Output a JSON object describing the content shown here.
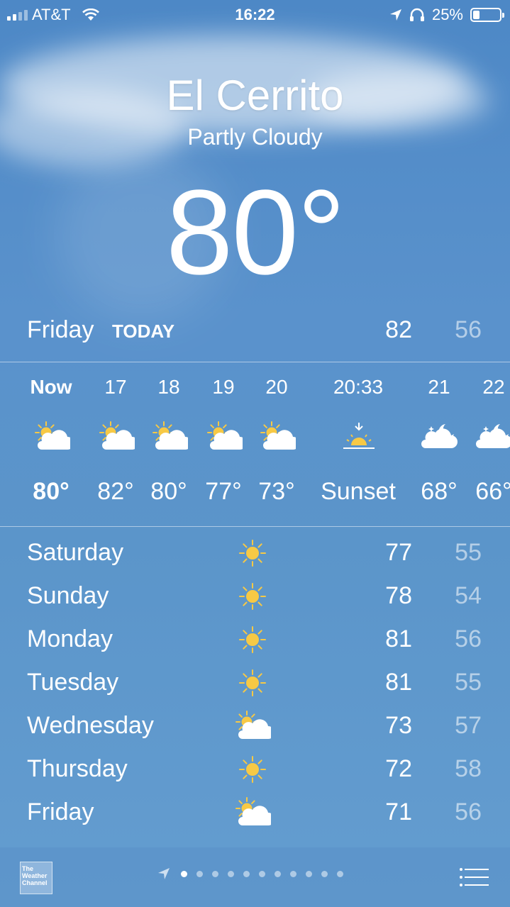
{
  "status_bar": {
    "carrier": "AT&T",
    "time": "16:22",
    "battery": "25%",
    "battery_level": 0.25
  },
  "header": {
    "city": "El Cerrito",
    "condition": "Partly Cloudy",
    "temperature": "80°"
  },
  "today": {
    "day": "Friday",
    "tag": "TODAY",
    "high": "82",
    "low": "56"
  },
  "hourly": [
    {
      "time": "Now",
      "icon": "partly-cloudy-day-icon",
      "value": "80°",
      "bold": true
    },
    {
      "time": "17",
      "icon": "partly-cloudy-day-icon",
      "value": "82°"
    },
    {
      "time": "18",
      "icon": "partly-cloudy-day-icon",
      "value": "80°"
    },
    {
      "time": "19",
      "icon": "partly-cloudy-day-icon",
      "value": "77°"
    },
    {
      "time": "20",
      "icon": "partly-cloudy-day-icon",
      "value": "73°"
    },
    {
      "time": "20:33",
      "icon": "sunset-icon",
      "value": "Sunset"
    },
    {
      "time": "21",
      "icon": "partly-cloudy-night-icon",
      "value": "68°"
    },
    {
      "time": "22",
      "icon": "partly-cloudy-night-icon",
      "value": "66°"
    }
  ],
  "daily": [
    {
      "day": "Saturday",
      "icon": "sun-icon",
      "high": "77",
      "low": "55"
    },
    {
      "day": "Sunday",
      "icon": "sun-icon",
      "high": "78",
      "low": "54"
    },
    {
      "day": "Monday",
      "icon": "sun-icon",
      "high": "81",
      "low": "56"
    },
    {
      "day": "Tuesday",
      "icon": "sun-icon",
      "high": "81",
      "low": "55"
    },
    {
      "day": "Wednesday",
      "icon": "partly-cloudy-day-icon",
      "high": "73",
      "low": "57"
    },
    {
      "day": "Thursday",
      "icon": "sun-icon",
      "high": "72",
      "low": "58"
    },
    {
      "day": "Friday",
      "icon": "partly-cloudy-day-icon",
      "high": "71",
      "low": "56"
    }
  ],
  "bottom_bar": {
    "logo_text": "The Weather Channel",
    "page_count": 11,
    "active_page": 0
  },
  "colors": {
    "sun": "#f7c945",
    "sky": "#5a92cc"
  }
}
